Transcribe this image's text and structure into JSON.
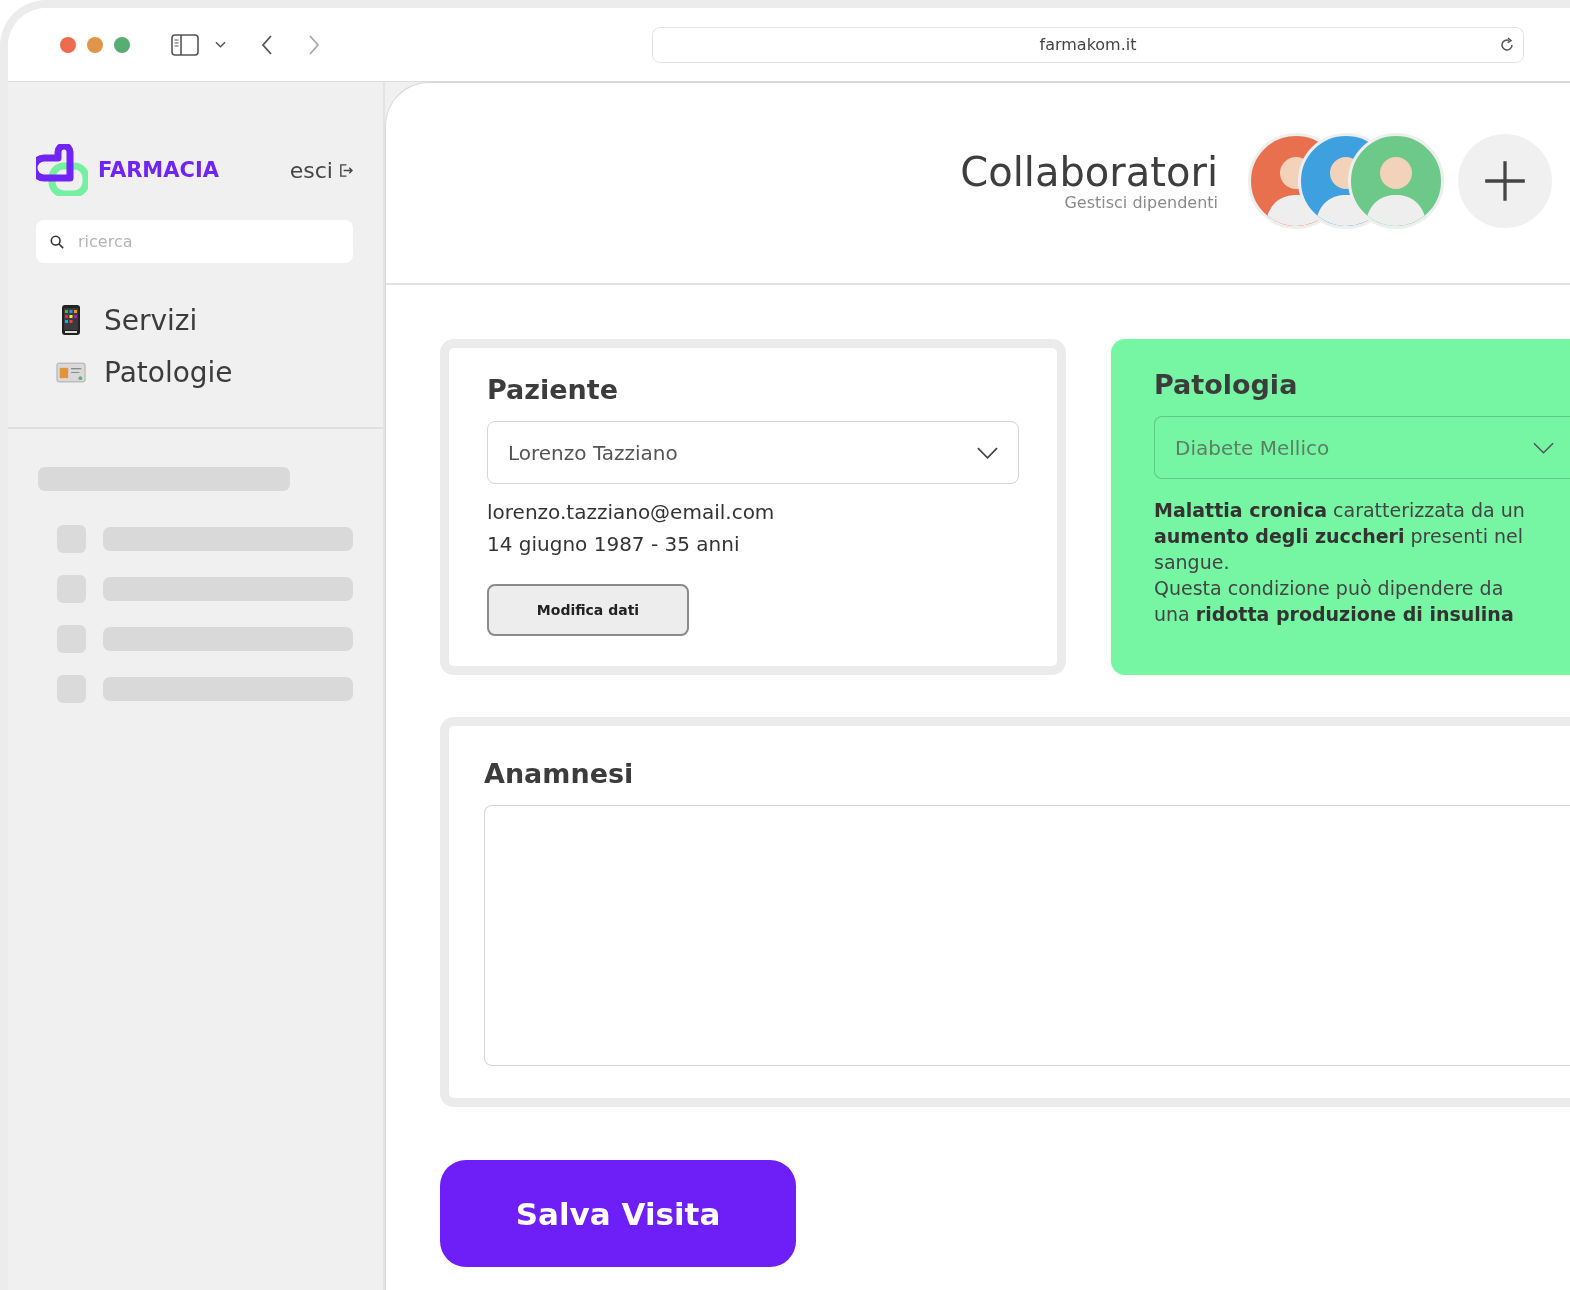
{
  "browser": {
    "url": "farmakom.it"
  },
  "sidebar": {
    "brand": "FARMACIA",
    "logout": "esci",
    "search": {
      "placeholder": "ricerca"
    },
    "items": [
      {
        "label": "Servizi",
        "kind": "phone"
      },
      {
        "label": "Patologie",
        "kind": "card"
      }
    ],
    "skeleton_rows": [
      {
        "kind": "row"
      },
      {
        "kind": "row"
      },
      {
        "kind": "row"
      },
      {
        "kind": "row"
      }
    ]
  },
  "header": {
    "title": "Collaboratori",
    "subtitle": "Gestisci dipendenti",
    "avatars": [
      {
        "kind": "person"
      },
      {
        "kind": "person"
      },
      {
        "kind": "person"
      }
    ]
  },
  "patient": {
    "title": "Paziente",
    "value": "Lorenzo Tazziano",
    "email": "lorenzo.tazziano@email.com",
    "birth": "14 giugno 1987 - 35 anni",
    "button": "Modifica dati"
  },
  "pathology": {
    "title": "Patologia",
    "value": "Diabete Mellico",
    "paragraphs": [
      "**Malattia cronica** caratterizzata da un **aumento degli zuccheri** presenti nel sangue.",
      "Questa condizione può dipendere da una **ridotta produzione di insulina**"
    ]
  },
  "anamnesis": {
    "title": "Anamnesi"
  },
  "save_button": "Salva Visita"
}
